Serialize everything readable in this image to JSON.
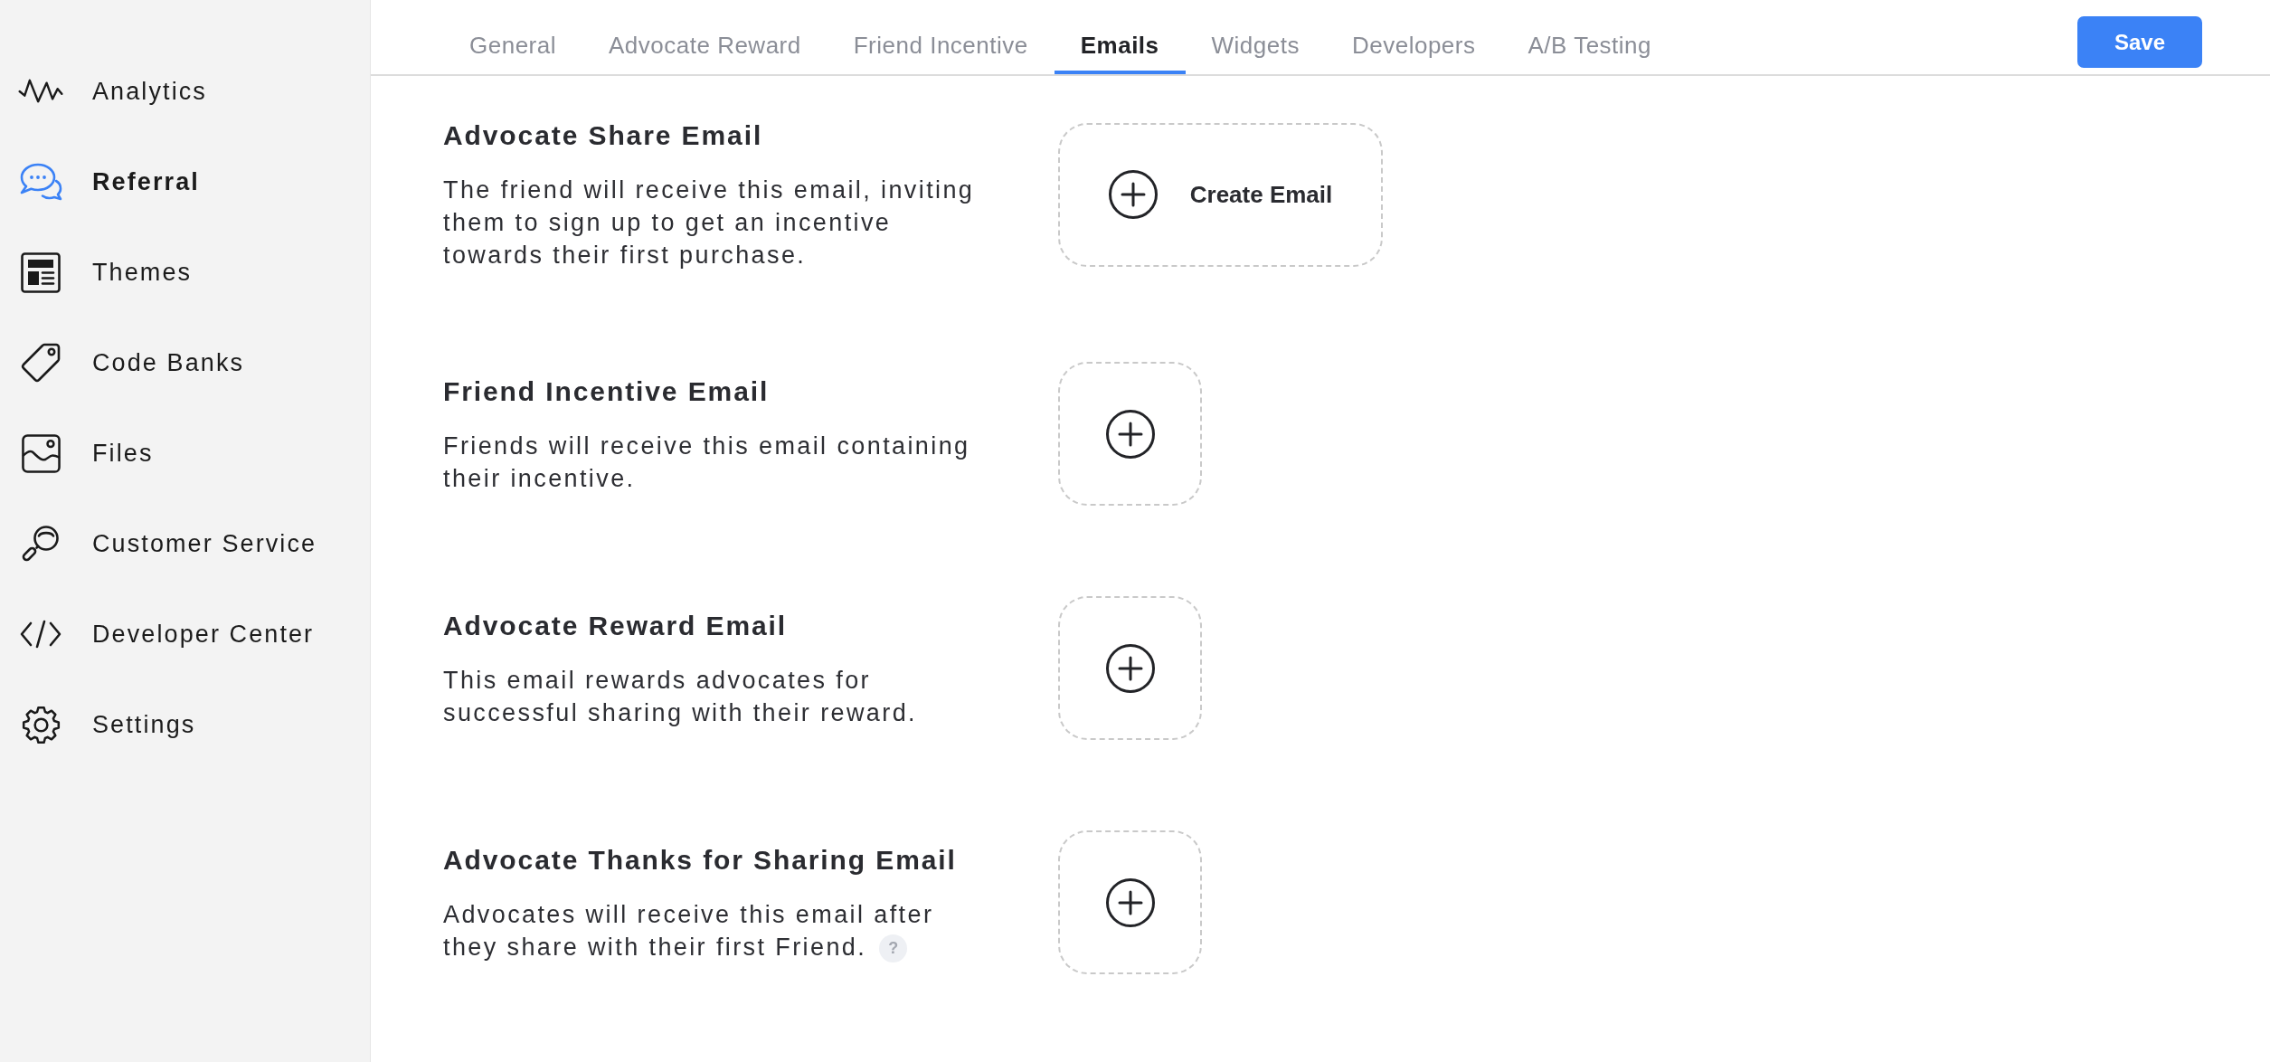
{
  "sidebar": {
    "items": [
      {
        "label": "Analytics",
        "selected": false
      },
      {
        "label": "Referral",
        "selected": true
      },
      {
        "label": "Themes",
        "selected": false
      },
      {
        "label": "Code Banks",
        "selected": false
      },
      {
        "label": "Files",
        "selected": false
      },
      {
        "label": "Customer Service",
        "selected": false
      },
      {
        "label": "Developer Center",
        "selected": false
      },
      {
        "label": "Settings",
        "selected": false
      }
    ]
  },
  "tabs": [
    {
      "label": "General",
      "selected": false
    },
    {
      "label": "Advocate Reward",
      "selected": false
    },
    {
      "label": "Friend Incentive",
      "selected": false
    },
    {
      "label": "Emails",
      "selected": true
    },
    {
      "label": "Widgets",
      "selected": false
    },
    {
      "label": "Developers",
      "selected": false
    },
    {
      "label": "A/B Testing",
      "selected": false
    }
  ],
  "save_button": {
    "label": "Save"
  },
  "emails": [
    {
      "title": "Advocate Share Email",
      "description": "The friend will receive this email, inviting them to sign up to get an incentive towards their first purchase.",
      "button_label": "Create Email"
    },
    {
      "title": "Friend Incentive Email",
      "description": "Friends will receive this email containing their incentive."
    },
    {
      "title": "Advocate Reward Email",
      "description": "This email rewards advocates for successful sharing with their reward."
    },
    {
      "title": "Advocate Thanks for Sharing Email",
      "description": "Advocates will receive this email after they share with their first Friend.",
      "help": "?"
    }
  ]
}
